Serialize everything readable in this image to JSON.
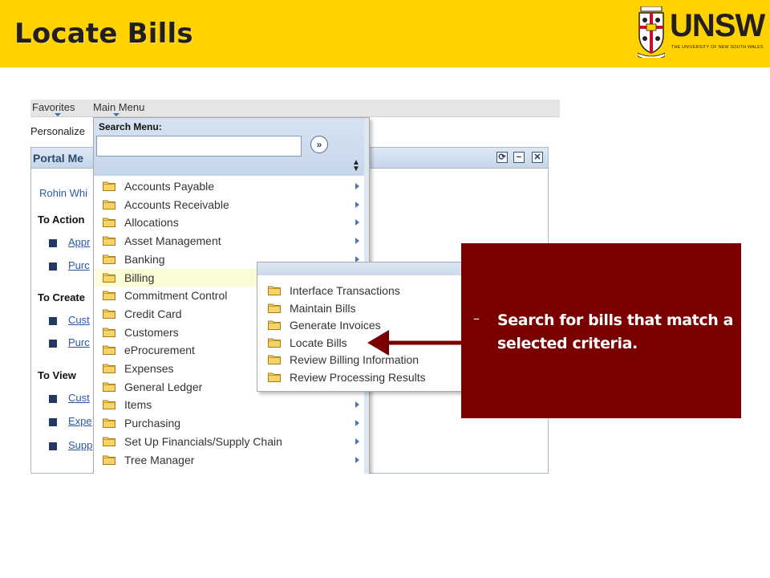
{
  "slide": {
    "title": "Locate Bills",
    "logo_text": "UNSW",
    "logo_subtext": "THE UNIVERSITY OF NEW SOUTH WALES",
    "header_color": "#FFD200",
    "callout_color": "#7A0000"
  },
  "nav": {
    "favorites": "Favorites",
    "main_menu": "Main Menu"
  },
  "personalize": "Personalize",
  "portal": {
    "title": "Portal Me",
    "user": "Rohin Whi",
    "controls": [
      "refresh-icon",
      "minimize-icon",
      "close-icon"
    ],
    "sections": [
      {
        "heading": "To Action",
        "links": [
          "Appr",
          "Purc"
        ]
      },
      {
        "heading": "To Create",
        "links": [
          "Cust",
          "Purc"
        ]
      },
      {
        "heading": "To View",
        "links": [
          "Cust",
          "Expe",
          "Supp"
        ]
      }
    ]
  },
  "search_menu": {
    "label": "Search Menu:",
    "value": "",
    "placeholder": ""
  },
  "menu_items": [
    {
      "label": "Accounts Payable",
      "has_submenu": true
    },
    {
      "label": "Accounts Receivable",
      "has_submenu": true
    },
    {
      "label": "Allocations",
      "has_submenu": true
    },
    {
      "label": "Asset Management",
      "has_submenu": true
    },
    {
      "label": "Banking",
      "has_submenu": true
    },
    {
      "label": "Billing",
      "has_submenu": true,
      "active": true
    },
    {
      "label": "Commitment Control",
      "has_submenu": false
    },
    {
      "label": "Credit Card",
      "has_submenu": false
    },
    {
      "label": "Customers",
      "has_submenu": false
    },
    {
      "label": "eProcurement",
      "has_submenu": false
    },
    {
      "label": "Expenses",
      "has_submenu": false
    },
    {
      "label": "General Ledger",
      "has_submenu": true
    },
    {
      "label": "Items",
      "has_submenu": true
    },
    {
      "label": "Purchasing",
      "has_submenu": true
    },
    {
      "label": "Set Up Financials/Supply Chain",
      "has_submenu": true
    },
    {
      "label": "Tree Manager",
      "has_submenu": true
    }
  ],
  "billing_submenu": [
    "Interface Transactions",
    "Maintain Bills",
    "Generate Invoices",
    "Locate Bills",
    "Review Billing Information",
    "Review Processing Results"
  ],
  "callout": {
    "dash": "–",
    "text": "Search for bills that match a selected criteria."
  }
}
